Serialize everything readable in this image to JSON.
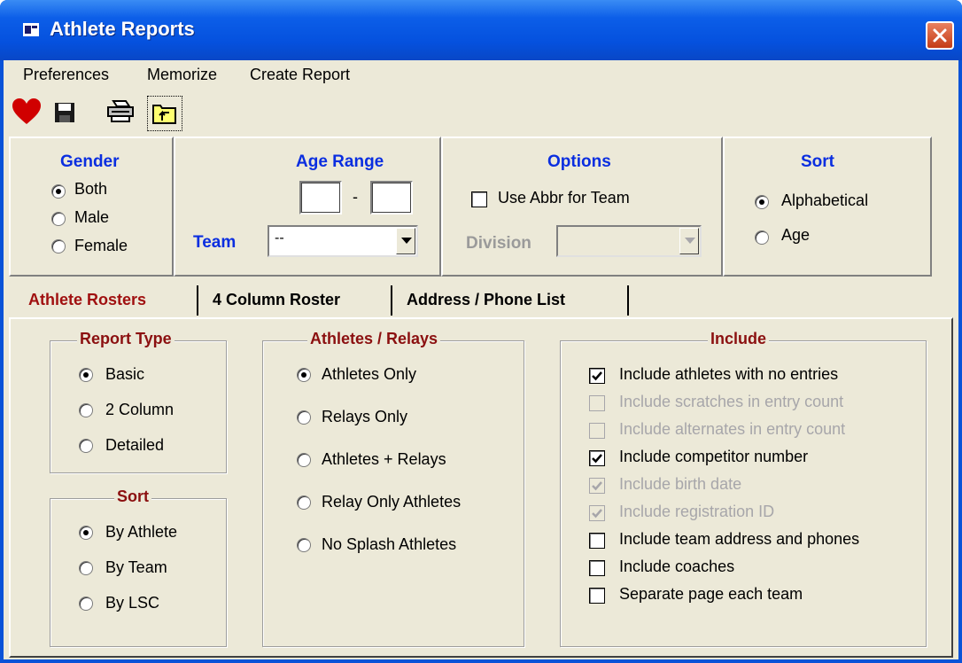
{
  "window": {
    "title": "Athlete Reports"
  },
  "menu": {
    "items": [
      "Preferences",
      "Memorize",
      "Create Report"
    ]
  },
  "toolbar": {
    "icons": [
      "heart-icon",
      "save-icon",
      "print-icon",
      "folder-up-icon"
    ]
  },
  "gender": {
    "label": "Gender",
    "options": [
      "Both",
      "Male",
      "Female"
    ],
    "selected": "Both"
  },
  "age_range": {
    "label": "Age Range",
    "separator": "-",
    "min": "",
    "max": ""
  },
  "team": {
    "label": "Team",
    "value": "--"
  },
  "options": {
    "label": "Options",
    "use_abbr_label": "Use Abbr for Team",
    "use_abbr_checked": false,
    "division_label": "Division",
    "division_value": ""
  },
  "sort_top": {
    "label": "Sort",
    "options": [
      "Alphabetical",
      "Age"
    ],
    "selected": "Alphabetical"
  },
  "tabs": {
    "items": [
      "Athlete Rosters",
      "4 Column Roster",
      "Address / Phone List"
    ],
    "active": "Athlete Rosters"
  },
  "report_type": {
    "label": "Report Type",
    "options": [
      "Basic",
      "2 Column",
      "Detailed"
    ],
    "selected": "Basic"
  },
  "sort_bottom": {
    "label": "Sort",
    "options": [
      "By Athlete",
      "By Team",
      "By LSC"
    ],
    "selected": "By Athlete"
  },
  "athletes_relays": {
    "label": "Athletes / Relays",
    "options": [
      "Athletes Only",
      "Relays Only",
      "Athletes + Relays",
      "Relay Only Athletes",
      "No Splash Athletes"
    ],
    "selected": "Athletes Only"
  },
  "include": {
    "label": "Include",
    "items": [
      {
        "label": "Include athletes with no entries",
        "checked": true,
        "enabled": true
      },
      {
        "label": "Include scratches in entry count",
        "checked": false,
        "enabled": false
      },
      {
        "label": "Include alternates in entry count",
        "checked": false,
        "enabled": false
      },
      {
        "label": "Include competitor number",
        "checked": true,
        "enabled": true
      },
      {
        "label": "Include birth date",
        "checked": true,
        "enabled": false
      },
      {
        "label": "Include registration ID",
        "checked": true,
        "enabled": false
      },
      {
        "label": "Include team address and phones",
        "checked": false,
        "enabled": true
      },
      {
        "label": "Include coaches",
        "checked": false,
        "enabled": true
      },
      {
        "label": "Separate page each team",
        "checked": false,
        "enabled": true
      }
    ]
  },
  "colors": {
    "titlebar": "#0551de",
    "face": "#ece9d8",
    "group_label": "#0a2ee0",
    "legend_label": "#8b1010",
    "active_tab": "#a01010"
  }
}
